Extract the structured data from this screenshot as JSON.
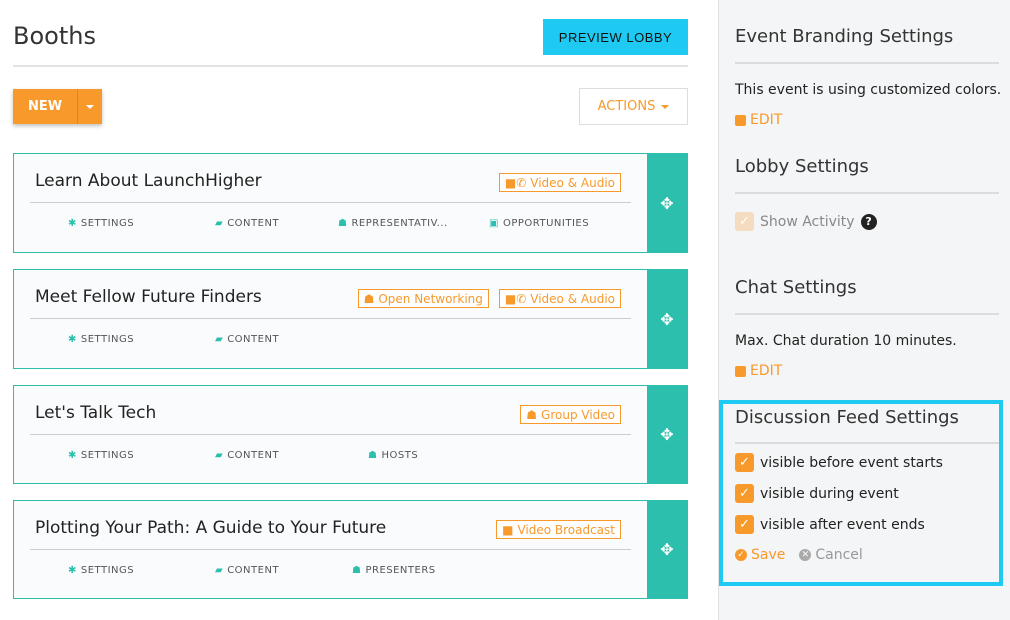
{
  "page": {
    "title": "Booths",
    "preview_label": "PREVIEW LOBBY",
    "new_label": "NEW",
    "actions_label": "ACTIONS"
  },
  "booths": [
    {
      "title": "Learn About LaunchHigher",
      "tags": [
        {
          "icon": "video-phone-icon",
          "label": "Video & Audio"
        }
      ],
      "links": [
        "SETTINGS",
        "CONTENT",
        "REPRESENTATIV...",
        "OPPORTUNITIES"
      ]
    },
    {
      "title": "Meet Fellow Future Finders",
      "tags": [
        {
          "icon": "people-icon",
          "label": "Open Networking"
        },
        {
          "icon": "video-phone-icon",
          "label": "Video & Audio"
        }
      ],
      "links": [
        "SETTINGS",
        "CONTENT"
      ]
    },
    {
      "title": "Let's Talk Tech",
      "tags": [
        {
          "icon": "people-icon",
          "label": "Group Video"
        }
      ],
      "links": [
        "SETTINGS",
        "CONTENT",
        "HOSTS"
      ]
    },
    {
      "title": "Plotting Your Path: A Guide to Your Future",
      "tags": [
        {
          "icon": "video-icon",
          "label": "Video Broadcast"
        }
      ],
      "links": [
        "SETTINGS",
        "CONTENT",
        "PRESENTERS"
      ]
    }
  ],
  "sidebar": {
    "branding": {
      "title": "Event Branding Settings",
      "text": "This event is using customized colors.",
      "edit_label": "EDIT"
    },
    "lobby": {
      "title": "Lobby Settings",
      "show_activity_label": "Show Activity"
    },
    "chat": {
      "title": "Chat Settings",
      "text": "Max. Chat duration 10 minutes.",
      "edit_label": "EDIT"
    },
    "discussion": {
      "title": "Discussion Feed Settings",
      "options": [
        "visible before event starts",
        "visible during event",
        "visible after event ends"
      ],
      "save_label": "Save",
      "cancel_label": "Cancel"
    }
  },
  "colors": {
    "accent": "#f7992b",
    "teal": "#2cbfad",
    "cyan": "#1ec9f2"
  }
}
